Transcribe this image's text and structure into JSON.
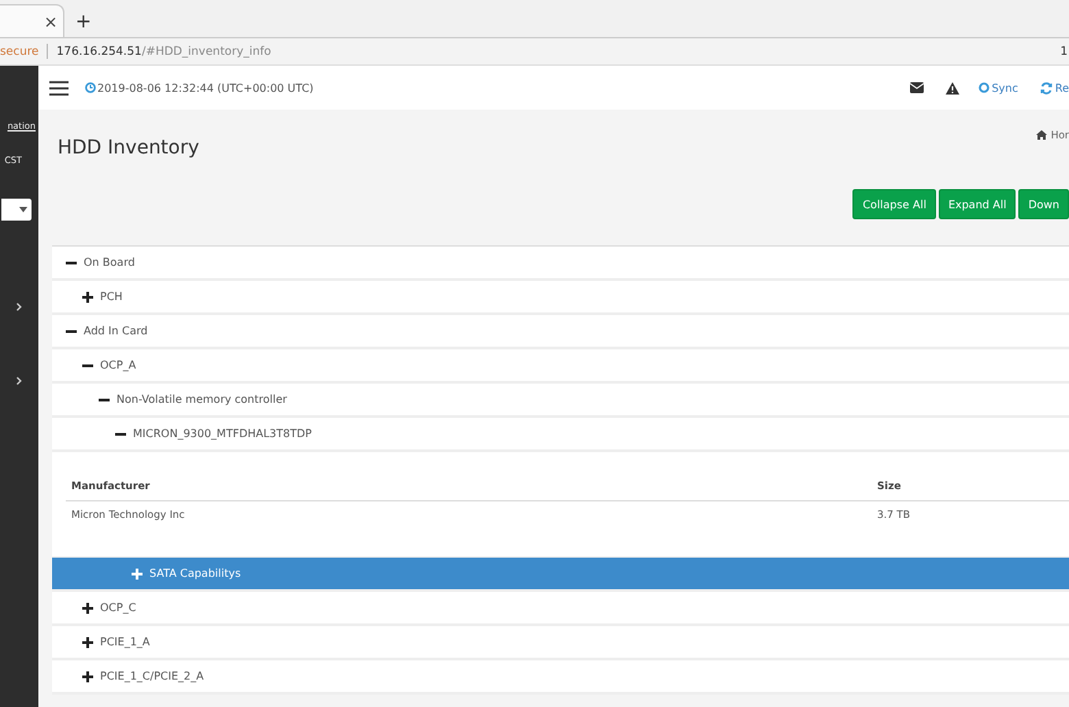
{
  "browser": {
    "tab_close": "×",
    "new_tab": "+",
    "security": "secure",
    "url_host": "176.16.254.51",
    "url_path": "/#HDD_inventory_info",
    "right_text": "1"
  },
  "sidebar": {
    "link": "nation",
    "label": "CST",
    "groups": [
      {
        "expanded": false
      },
      {
        "expanded": false
      }
    ]
  },
  "header": {
    "datetime": "2019-08-06 12:32:44 (UTC+00:00 UTC)",
    "sync": "Sync",
    "refresh": "Re"
  },
  "page": {
    "title": "HDD Inventory",
    "breadcrumb": "Hor"
  },
  "buttons": [
    "Collapse All",
    "Expand All",
    "Down"
  ],
  "tree": [
    {
      "label": "On Board",
      "expanded": true,
      "selected": false,
      "children": [
        {
          "label": "PCH",
          "expanded": false,
          "selected": false
        }
      ]
    },
    {
      "label": "Add In Card",
      "expanded": true,
      "selected": false,
      "children": [
        {
          "label": "OCP_A",
          "expanded": true,
          "selected": false,
          "children": [
            {
              "label": "Non-Volatile memory controller",
              "expanded": true,
              "selected": false,
              "children": [
                {
                  "label": "MICRON_9300_MTFDHAL3T8TDP",
                  "expanded": true,
                  "selected": false,
                  "details": {
                    "columns": [
                      "Manufacturer",
                      "Size"
                    ],
                    "rows": [
                      [
                        "Micron Technology Inc",
                        "3.7 TB"
                      ]
                    ]
                  },
                  "children": [
                    {
                      "label": "SATA Capabilitys",
                      "expanded": false,
                      "selected": true
                    }
                  ]
                }
              ]
            }
          ]
        },
        {
          "label": "OCP_C",
          "expanded": false,
          "selected": false
        },
        {
          "label": "PCIE_1_A",
          "expanded": false,
          "selected": false
        },
        {
          "label": "PCIE_1_C/PCIE_2_A",
          "expanded": false,
          "selected": false
        }
      ]
    }
  ]
}
